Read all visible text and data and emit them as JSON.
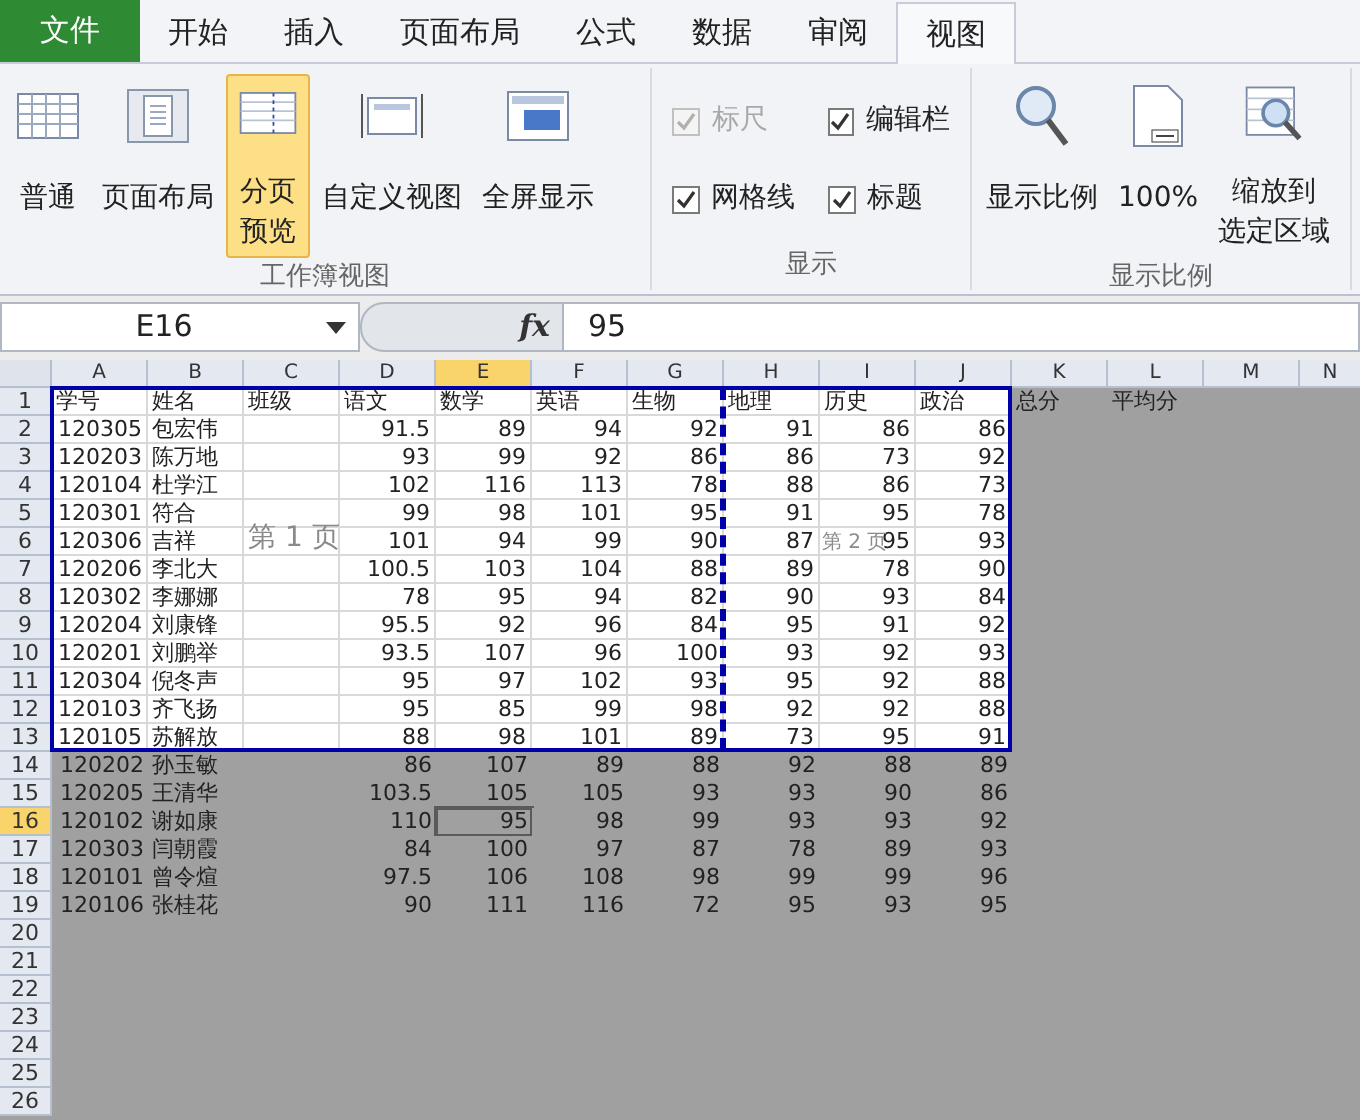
{
  "tabs": [
    {
      "label": "文件",
      "kind": "file",
      "selected": false
    },
    {
      "label": "开始",
      "kind": "tab",
      "selected": false
    },
    {
      "label": "插入",
      "kind": "tab",
      "selected": false
    },
    {
      "label": "页面布局",
      "kind": "tab",
      "selected": false
    },
    {
      "label": "公式",
      "kind": "tab",
      "selected": false
    },
    {
      "label": "数据",
      "kind": "tab",
      "selected": false
    },
    {
      "label": "审阅",
      "kind": "tab",
      "selected": false
    },
    {
      "label": "视图",
      "kind": "tab",
      "selected": true
    }
  ],
  "ribbon_groups": [
    {
      "title": "工作簿视图",
      "kind": "buttons",
      "items": [
        {
          "lines": [
            "普通"
          ],
          "selected": false
        },
        {
          "lines": [
            "页面布局"
          ],
          "selected": false
        },
        {
          "lines": [
            "分页",
            "预览"
          ],
          "selected": true
        },
        {
          "lines": [
            "自定义视图"
          ],
          "selected": false
        },
        {
          "lines": [
            "全屏显示"
          ],
          "selected": false
        }
      ]
    },
    {
      "title": "显示",
      "kind": "checks",
      "items": [
        {
          "label": "标尺",
          "checked": true,
          "disabled": true
        },
        {
          "label": "编辑栏",
          "checked": true,
          "disabled": false
        },
        {
          "label": "网格线",
          "checked": true,
          "disabled": false
        },
        {
          "label": "标题",
          "checked": true,
          "disabled": false
        }
      ]
    },
    {
      "title": "显示比例",
      "kind": "buttons",
      "items": [
        {
          "lines": [
            "显示比例"
          ],
          "selected": false
        },
        {
          "lines": [
            "100%"
          ],
          "selected": false
        },
        {
          "lines": [
            "缩放到",
            "选定区域"
          ],
          "selected": false
        }
      ]
    }
  ],
  "formula_bar": {
    "name_box": "E16",
    "function_label": "fx",
    "value": "95"
  },
  "columns": [
    {
      "label": "A",
      "selected": false,
      "in_print_area": true,
      "page_break_after": false
    },
    {
      "label": "B",
      "selected": false,
      "in_print_area": true,
      "page_break_after": false
    },
    {
      "label": "C",
      "selected": false,
      "in_print_area": true,
      "page_break_after": false
    },
    {
      "label": "D",
      "selected": false,
      "in_print_area": true,
      "page_break_after": false
    },
    {
      "label": "E",
      "selected": true,
      "in_print_area": true,
      "page_break_after": false
    },
    {
      "label": "F",
      "selected": false,
      "in_print_area": true,
      "page_break_after": false
    },
    {
      "label": "G",
      "selected": false,
      "in_print_area": true,
      "page_break_after": true
    },
    {
      "label": "H",
      "selected": false,
      "in_print_area": true,
      "page_break_after": false
    },
    {
      "label": "I",
      "selected": false,
      "in_print_area": true,
      "page_break_after": false
    },
    {
      "label": "J",
      "selected": false,
      "in_print_area": true,
      "page_break_after": false
    },
    {
      "label": "K",
      "selected": false,
      "in_print_area": false,
      "page_break_after": false
    },
    {
      "label": "L",
      "selected": false,
      "in_print_area": false,
      "page_break_after": false
    },
    {
      "label": "M",
      "selected": false,
      "in_print_area": false,
      "page_break_after": false
    },
    {
      "label": "N",
      "selected": false,
      "in_print_area": false,
      "page_break_after": false
    }
  ],
  "rows": [
    {
      "header": "1",
      "selected": false,
      "in_print_area": true,
      "kind": "header",
      "cells": [
        "学号",
        "姓名",
        "班级",
        "语文",
        "数学",
        "英语",
        "生物",
        "地理",
        "历史",
        "政治",
        "总分",
        "平均分"
      ]
    },
    {
      "header": "2",
      "selected": false,
      "in_print_area": true,
      "kind": "data",
      "cells": [
        "120305",
        "包宏伟",
        null,
        "91.5",
        "89",
        "94",
        "92",
        "91",
        "86",
        "86"
      ]
    },
    {
      "header": "3",
      "selected": false,
      "in_print_area": true,
      "kind": "data",
      "cells": [
        "120203",
        "陈万地",
        null,
        "93",
        "99",
        "92",
        "86",
        "86",
        "73",
        "92"
      ]
    },
    {
      "header": "4",
      "selected": false,
      "in_print_area": true,
      "kind": "data",
      "cells": [
        "120104",
        "杜学江",
        null,
        "102",
        "116",
        "113",
        "78",
        "88",
        "86",
        "73"
      ]
    },
    {
      "header": "5",
      "selected": false,
      "in_print_area": true,
      "kind": "data",
      "cells": [
        "120301",
        "符合",
        null,
        "99",
        "98",
        "101",
        "95",
        "91",
        "95",
        "78"
      ]
    },
    {
      "header": "6",
      "selected": false,
      "in_print_area": true,
      "kind": "data",
      "cells": [
        "120306",
        "吉祥",
        null,
        "101",
        "94",
        "99",
        "90",
        "87",
        "95",
        "93"
      ]
    },
    {
      "header": "7",
      "selected": false,
      "in_print_area": true,
      "kind": "data",
      "cells": [
        "120206",
        "李北大",
        null,
        "100.5",
        "103",
        "104",
        "88",
        "89",
        "78",
        "90"
      ]
    },
    {
      "header": "8",
      "selected": false,
      "in_print_area": true,
      "kind": "data",
      "cells": [
        "120302",
        "李娜娜",
        null,
        "78",
        "95",
        "94",
        "82",
        "90",
        "93",
        "84"
      ]
    },
    {
      "header": "9",
      "selected": false,
      "in_print_area": true,
      "kind": "data",
      "cells": [
        "120204",
        "刘康锋",
        null,
        "95.5",
        "92",
        "96",
        "84",
        "95",
        "91",
        "92"
      ]
    },
    {
      "header": "10",
      "selected": false,
      "in_print_area": true,
      "kind": "data",
      "cells": [
        "120201",
        "刘鹏举",
        null,
        "93.5",
        "107",
        "96",
        "100",
        "93",
        "92",
        "93"
      ]
    },
    {
      "header": "11",
      "selected": false,
      "in_print_area": true,
      "kind": "data",
      "cells": [
        "120304",
        "倪冬声",
        null,
        "95",
        "97",
        "102",
        "93",
        "95",
        "92",
        "88"
      ]
    },
    {
      "header": "12",
      "selected": false,
      "in_print_area": true,
      "kind": "data",
      "cells": [
        "120103",
        "齐飞扬",
        null,
        "95",
        "85",
        "99",
        "98",
        "92",
        "92",
        "88"
      ]
    },
    {
      "header": "13",
      "selected": false,
      "in_print_area": true,
      "kind": "data",
      "cells": [
        "120105",
        "苏解放",
        null,
        "88",
        "98",
        "101",
        "89",
        "73",
        "95",
        "91"
      ]
    },
    {
      "header": "14",
      "selected": false,
      "in_print_area": false,
      "kind": "data",
      "cells": [
        "120202",
        "孙玉敏",
        null,
        "86",
        "107",
        "89",
        "88",
        "92",
        "88",
        "89"
      ]
    },
    {
      "header": "15",
      "selected": false,
      "in_print_area": false,
      "kind": "data",
      "cells": [
        "120205",
        "王清华",
        null,
        "103.5",
        "105",
        "105",
        "93",
        "93",
        "90",
        "86"
      ]
    },
    {
      "header": "16",
      "selected": true,
      "in_print_area": false,
      "kind": "data",
      "cells": [
        "120102",
        "谢如康",
        null,
        "110",
        "95",
        "98",
        "99",
        "93",
        "93",
        "92"
      ]
    },
    {
      "header": "17",
      "selected": false,
      "in_print_area": false,
      "kind": "data",
      "cells": [
        "120303",
        "闫朝霞",
        null,
        "84",
        "100",
        "97",
        "87",
        "78",
        "89",
        "93"
      ]
    },
    {
      "header": "18",
      "selected": false,
      "in_print_area": false,
      "kind": "data",
      "cells": [
        "120101",
        "曾令煊",
        null,
        "97.5",
        "106",
        "108",
        "98",
        "99",
        "99",
        "96"
      ]
    },
    {
      "header": "19",
      "selected": false,
      "in_print_area": false,
      "kind": "data",
      "cells": [
        "120106",
        "张桂花",
        null,
        "90",
        "111",
        "116",
        "72",
        "95",
        "93",
        "95"
      ]
    },
    {
      "header": "20",
      "selected": false,
      "in_print_area": false,
      "kind": "data"
    },
    {
      "header": "21",
      "selected": false,
      "in_print_area": false,
      "kind": "data"
    },
    {
      "header": "22",
      "selected": false,
      "in_print_area": false,
      "kind": "data"
    },
    {
      "header": "23",
      "selected": false,
      "in_print_area": false,
      "kind": "data"
    },
    {
      "header": "24",
      "selected": false,
      "in_print_area": false,
      "kind": "data"
    },
    {
      "header": "25",
      "selected": false,
      "in_print_area": false,
      "kind": "data"
    },
    {
      "header": "26",
      "selected": false,
      "in_print_area": false,
      "kind": "data"
    }
  ],
  "page_labels": [
    {
      "text": "第 1 页"
    },
    {
      "text": "第 2 页"
    }
  ]
}
